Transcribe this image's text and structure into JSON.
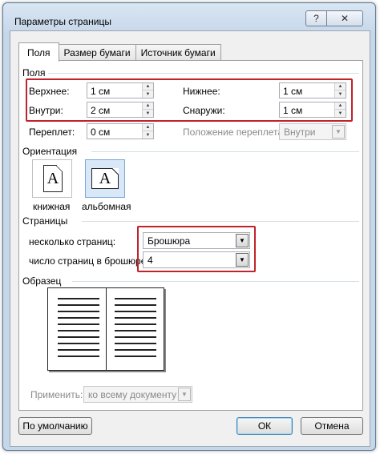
{
  "window": {
    "title": "Параметры страницы",
    "help_label": "?",
    "close_label": "✕"
  },
  "tabs": [
    {
      "label": "Поля",
      "active": true
    },
    {
      "label": "Размер бумаги",
      "active": false
    },
    {
      "label": "Источник бумаги",
      "active": false
    }
  ],
  "margins": {
    "group_label": "Поля",
    "top_label": "Верхнее:",
    "top_value": "1 см",
    "bottom_label": "Нижнее:",
    "bottom_value": "1 см",
    "inside_label": "Внутри:",
    "inside_value": "2 см",
    "outside_label": "Снаружи:",
    "outside_value": "1 см",
    "gutter_label": "Переплет:",
    "gutter_value": "0 см",
    "gutter_pos_label": "Положение переплета:",
    "gutter_pos_value": "Внутри"
  },
  "orientation": {
    "group_label": "Ориентация",
    "portrait_label": "книжная",
    "portrait_glyph": "A",
    "landscape_label": "альбомная",
    "landscape_glyph": "A",
    "selected": "альбомная"
  },
  "pages": {
    "group_label": "Страницы",
    "multiple_label": "несколько страниц:",
    "multiple_value": "Брошюра",
    "booklet_label": "число страниц в брошюре:",
    "booklet_value": "4"
  },
  "preview": {
    "group_label": "Образец"
  },
  "apply": {
    "label": "Применить:",
    "value": "ко всему документу"
  },
  "buttons": {
    "default_label": "По умолчанию",
    "ok_label": "ОК",
    "cancel_label": "Отмена"
  },
  "colors": {
    "highlight": "#c0232b",
    "selection": "#d8e8f8"
  }
}
